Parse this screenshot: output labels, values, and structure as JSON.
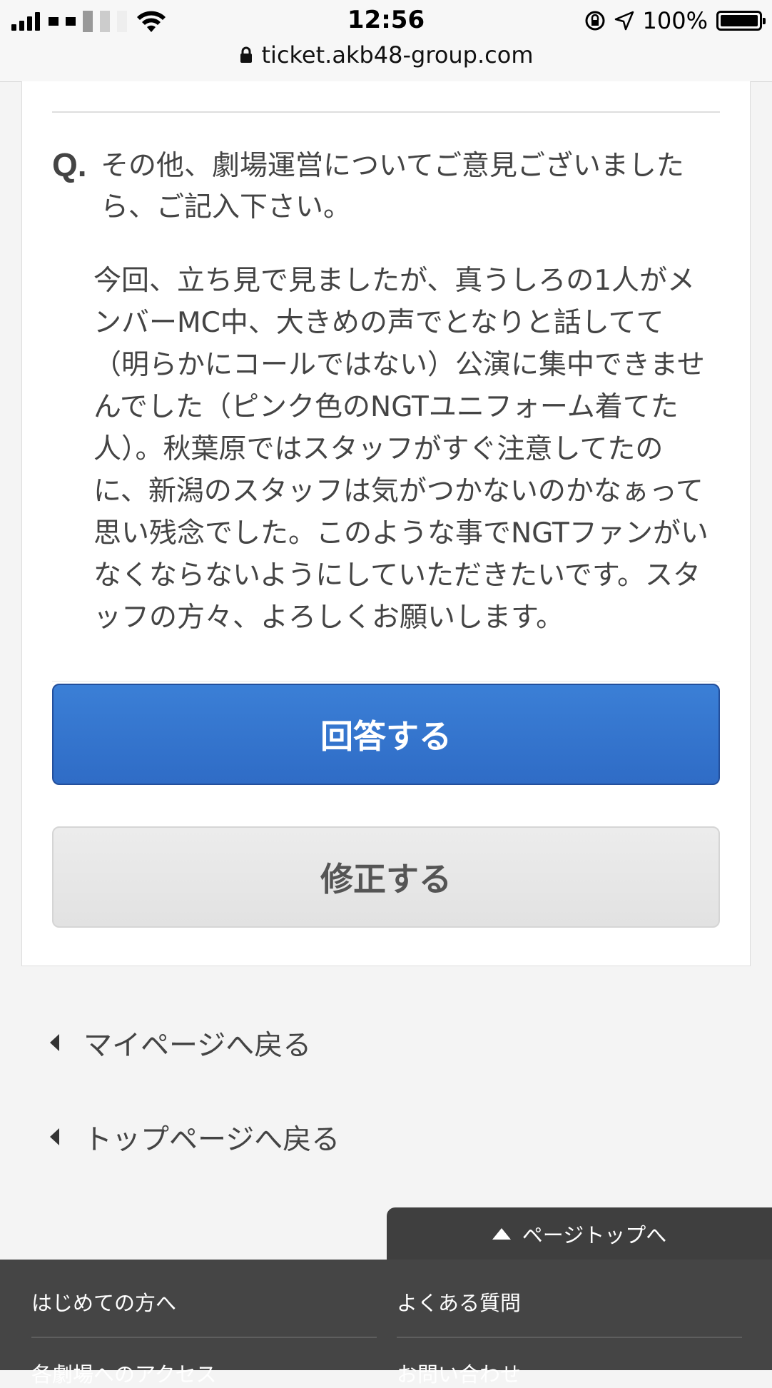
{
  "status_bar": {
    "time": "12:56",
    "battery": "100%",
    "url": "ticket.akb48-group.com"
  },
  "question": {
    "mark": "Q.",
    "text": "その他、劇場運営についてご意見ございましたら、ご記入下さい。",
    "answer": "今回、立ち見で見ましたが、真うしろの1人がメンバーMC中、大きめの声でとなりと話してて（明らかにコールではない）公演に集中できませんでした（ピンク色のNGTユニフォーム着てた人）。秋葉原ではスタッフがすぐ注意してたのに、新潟のスタッフは気がつかないのかなぁって思い残念でした。このような事でNGTファンがいなくならないようにしていただきたいです。スタッフの方々、よろしくお願いします。"
  },
  "buttons": {
    "submit": "回答する",
    "edit": "修正する"
  },
  "links": {
    "mypage": "マイページへ戻る",
    "toppage": "トップページへ戻る",
    "pagetop": "ページトップへ"
  },
  "footer": {
    "items": [
      "はじめての方へ",
      "よくある質問",
      "各劇場へのアクセス",
      "お問い合わせ"
    ]
  },
  "colors": {
    "primary_button": "#2f6cc6",
    "footer_bg": "#454545"
  }
}
